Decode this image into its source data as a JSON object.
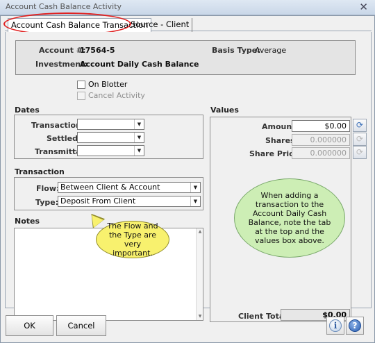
{
  "window": {
    "title": "Account Cash Balance Activity"
  },
  "tabs": [
    {
      "label": "Account Cash Balance Transaction"
    },
    {
      "label": "Source - Client"
    }
  ],
  "info": {
    "account_label": "Account #:",
    "account_value": "17564-5",
    "investment_label": "Investment:",
    "investment_value": "Account Daily Cash Balance",
    "basis_label": "Basis Type:",
    "basis_value": "Average"
  },
  "checkboxes": {
    "on_blotter": "On Blotter",
    "cancel_activity": "Cancel Activity"
  },
  "dates": {
    "title": "Dates",
    "transaction_label": "Transaction:",
    "settled_label": "Settled:",
    "transmittal_label": "Transmittal:"
  },
  "transaction": {
    "title": "Transaction",
    "flow_label": "Flow:",
    "flow_value": "Between Client & Account",
    "type_label": "Type:",
    "type_value": "Deposit From Client"
  },
  "notes": {
    "title": "Notes"
  },
  "values": {
    "title": "Values",
    "amount_label": "Amount:",
    "amount_value": "$0.00",
    "shares_label": "Shares:",
    "shares_value": "0.000000",
    "share_price_label": "Share Price:",
    "share_price_value": "0.000000",
    "client_total_label": "Client Total:",
    "client_total_value": "$0.00"
  },
  "annotations": {
    "green": "When adding a transaction to the Account Daily Cash Balance, note the tab at the top and the values box above.",
    "yellow": "The Flow and the Type are very important."
  },
  "buttons": {
    "ok": "OK",
    "cancel": "Cancel"
  },
  "icons": {
    "close": "close-icon",
    "info": "info-icon",
    "help": "help-icon",
    "calc": "calculator-icon",
    "dropdown": "chevron-down-icon"
  }
}
